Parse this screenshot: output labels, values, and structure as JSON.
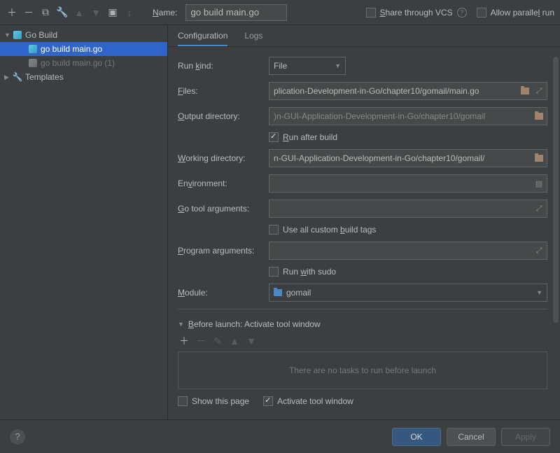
{
  "toolbar": {
    "name_label": "Name:",
    "name_value": "go build main.go",
    "share_label": "Share through VCS",
    "parallel_label": "Allow parallel run"
  },
  "sidebar": {
    "groups": [
      {
        "label": "Go Build",
        "icon": "go"
      },
      {
        "label": "Templates",
        "icon": "wrench"
      }
    ],
    "items": [
      {
        "label": "go build main.go",
        "selected": true
      },
      {
        "label": "go build main.go (1)",
        "selected": false
      }
    ]
  },
  "tabs": [
    {
      "label": "Configuration",
      "active": true
    },
    {
      "label": "Logs",
      "active": false
    }
  ],
  "form": {
    "run_kind_label": "Run kind:",
    "run_kind_value": "File",
    "files_label": "Files:",
    "files_value": "plication-Development-in-Go/chapter10/gomail/main.go",
    "output_dir_label": "Output directory:",
    "output_dir_value": ")n-GUI-Application-Development-in-Go/chapter10/gomail",
    "run_after_build_label": "Run after build",
    "working_dir_label": "Working directory:",
    "working_dir_value": "n-GUI-Application-Development-in-Go/chapter10/gomail/",
    "environment_label": "Environment:",
    "environment_value": "",
    "go_tool_args_label": "Go tool arguments:",
    "go_tool_args_value": "",
    "use_custom_tags_label": "Use all custom build tags",
    "program_args_label": "Program arguments:",
    "program_args_value": "",
    "run_sudo_label": "Run with sudo",
    "module_label": "Module:",
    "module_value": "gomail"
  },
  "before_launch": {
    "header": "Before launch: Activate tool window",
    "empty_text": "There are no tasks to run before launch",
    "show_page_label": "Show this page",
    "activate_window_label": "Activate tool window"
  },
  "buttons": {
    "ok": "OK",
    "cancel": "Cancel",
    "apply": "Apply"
  }
}
